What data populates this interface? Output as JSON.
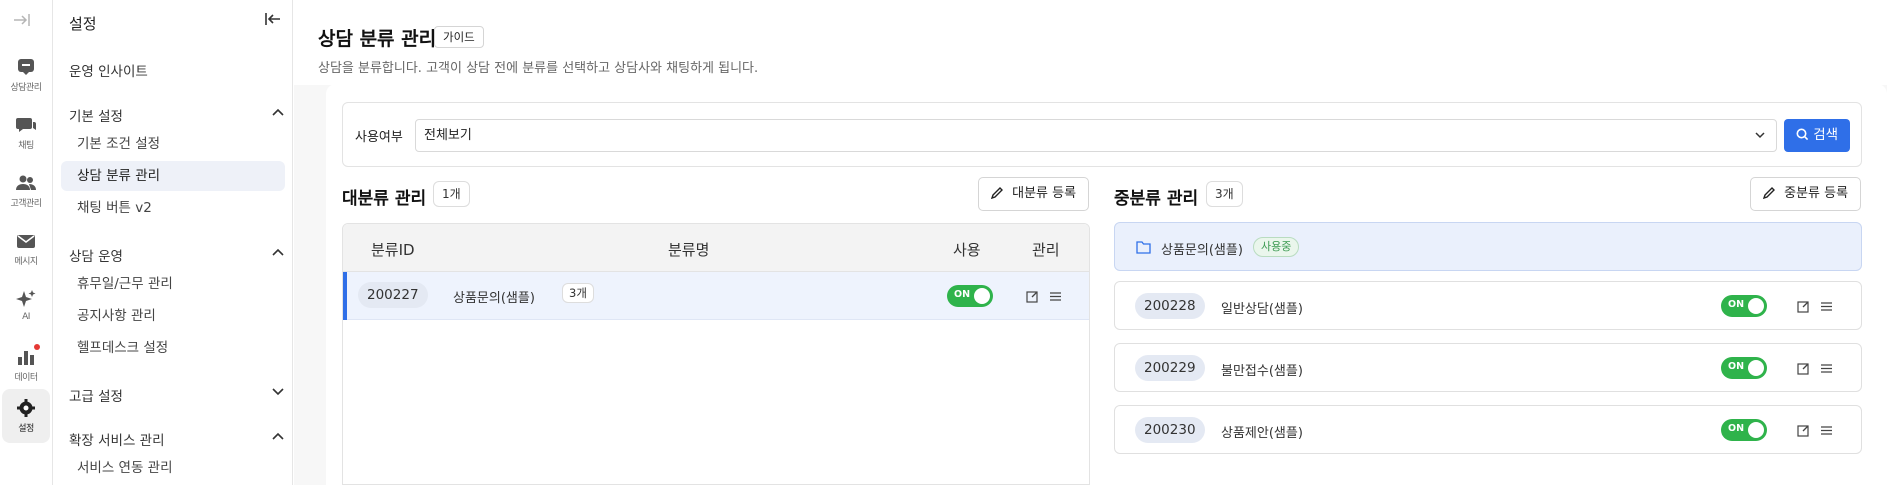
{
  "rail": {
    "items": [
      {
        "label": "상담관리",
        "icon": "headset-icon"
      },
      {
        "label": "채팅",
        "icon": "chat-icon"
      },
      {
        "label": "고객관리",
        "icon": "users-icon"
      },
      {
        "label": "메시지",
        "icon": "mail-icon"
      },
      {
        "label": "AI",
        "icon": "sparkle-icon"
      },
      {
        "label": "데이터",
        "icon": "bar-chart-icon"
      },
      {
        "label": "설정",
        "icon": "gear-icon"
      }
    ]
  },
  "nav": {
    "title": "설정",
    "insight": "운영 인사이트",
    "groups": [
      {
        "label": "기본 설정",
        "items": [
          "기본 조건 설정",
          "상담 분류 관리",
          "채팅 버튼 v2"
        ]
      },
      {
        "label": "상담 운영",
        "items": [
          "휴무일/근무 관리",
          "공지사항 관리",
          "헬프데스크 설정"
        ]
      },
      {
        "label": "고급 설정",
        "items": []
      },
      {
        "label": "확장 서비스 관리",
        "items": [
          "서비스 연동 관리"
        ]
      }
    ]
  },
  "page": {
    "title": "상담 분류 관리",
    "guide": "가이드",
    "description": "상담을 분류합니다. 고객이 상담 전에 분류를 선택하고 상담사와 채팅하게 됩니다."
  },
  "filter": {
    "label": "사용여부",
    "value": "전체보기",
    "search": "검색"
  },
  "major": {
    "title": "대분류 관리",
    "count": "1개",
    "add": "대분류 등록",
    "columns": [
      "분류ID",
      "분류명",
      "사용",
      "관리"
    ],
    "rows": [
      {
        "id": "200227",
        "name": "상품문의(샘플)",
        "sub_count": "3개",
        "toggle": "ON"
      }
    ]
  },
  "middle": {
    "title": "중분류 관리",
    "count": "3개",
    "add": "중분류 등록",
    "parent": {
      "name": "상품문의(샘플)",
      "status": "사용중"
    },
    "rows": [
      {
        "id": "200228",
        "name": "일반상담(샘플)",
        "toggle": "ON"
      },
      {
        "id": "200229",
        "name": "불만접수(샘플)",
        "toggle": "ON"
      },
      {
        "id": "200230",
        "name": "상품제안(샘플)",
        "toggle": "ON"
      }
    ]
  },
  "colors": {
    "accent": "#2f6fe8",
    "toggle_on": "#2fb34b",
    "selected_row": "#eef3fd"
  }
}
